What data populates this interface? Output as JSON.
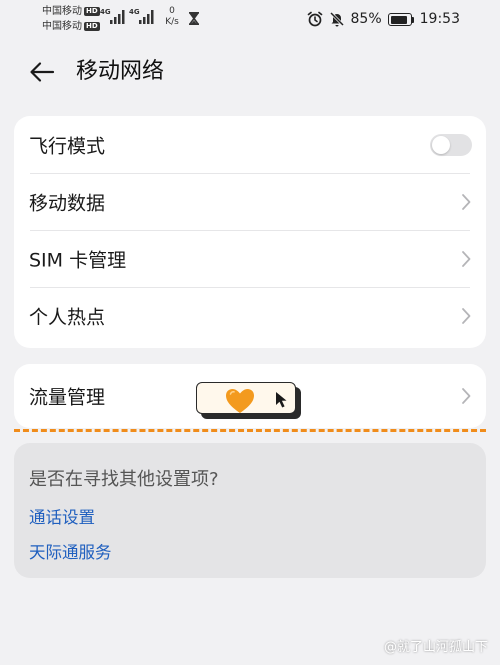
{
  "status_bar": {
    "carrier_1": "中国移动",
    "carrier_2": "中国移动",
    "hd_badge": "HD",
    "network_gen_1": "4G",
    "network_gen_2": "4G",
    "speed_value": "0",
    "speed_unit": "K/s",
    "battery": "85%",
    "time": "19:53",
    "icons": [
      "alarm-icon",
      "mute-icon",
      "battery-icon",
      "signal-icon",
      "hourglass-icon"
    ]
  },
  "header": {
    "title": "移动网络",
    "back_icon": "back-arrow-icon"
  },
  "settings": {
    "items": [
      {
        "label": "飞行模式",
        "control": "toggle",
        "enabled": false
      },
      {
        "label": "移动数据",
        "control": "chevron"
      },
      {
        "label": "SIM 卡管理",
        "control": "chevron"
      },
      {
        "label": "个人热点",
        "control": "chevron"
      }
    ]
  },
  "traffic": {
    "label": "流量管理",
    "control": "chevron"
  },
  "sticker": {
    "icons": [
      "orange-heart-icon",
      "cursor-icon"
    ]
  },
  "suggestions": {
    "title": "是否在寻找其他设置项?",
    "links": [
      "通话设置",
      "天际通服务"
    ]
  },
  "watermark": {
    "text": "@就了山河孤山下"
  },
  "colors": {
    "background": "#f1f1f3",
    "card": "#ffffff",
    "suggestion_card": "#e4e4e6",
    "link": "#1f5fbf",
    "dashed_divider": "#f08c1b",
    "heart": "#f39a1e"
  }
}
